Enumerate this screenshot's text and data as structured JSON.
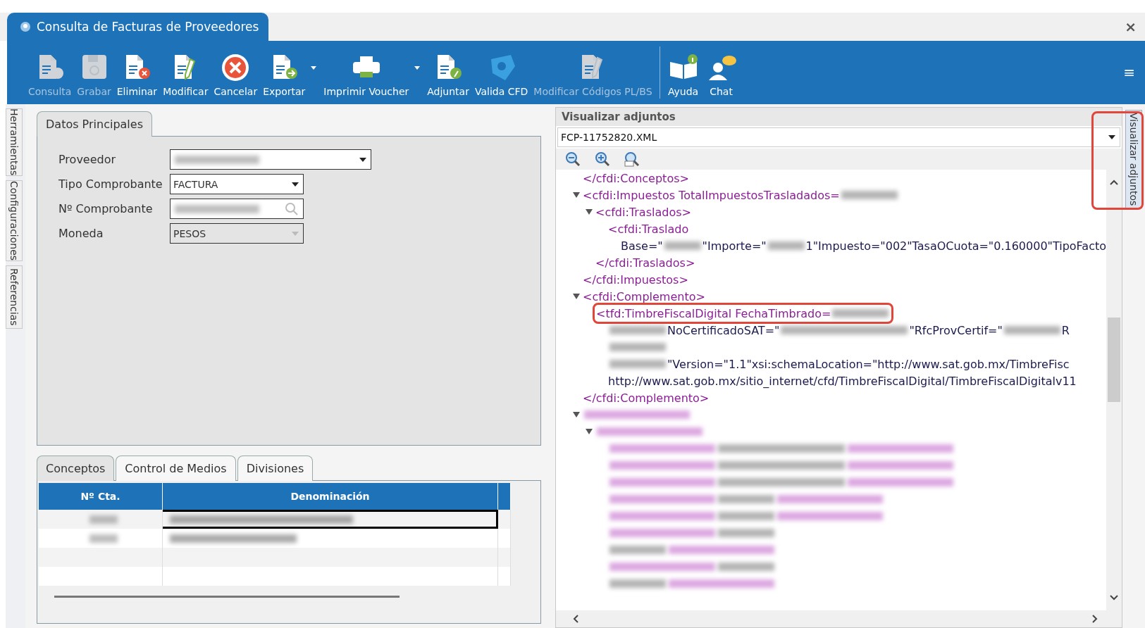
{
  "window": {
    "title": "Consulta de Facturas de Proveedores",
    "close": "×"
  },
  "toolbar": {
    "buttons": [
      {
        "label": "Consulta",
        "disabled": true
      },
      {
        "label": "Grabar",
        "disabled": true
      },
      {
        "label": "Eliminar",
        "disabled": false
      },
      {
        "label": "Modificar",
        "disabled": false
      },
      {
        "label": "Cancelar",
        "disabled": false
      },
      {
        "label": "Exportar",
        "disabled": false,
        "dropdown": true
      },
      {
        "label": "Imprimir Voucher",
        "disabled": false,
        "dropdown": true
      },
      {
        "label": "Adjuntar",
        "disabled": false
      },
      {
        "label": "Valida CFD",
        "disabled": false
      },
      {
        "label": "Modificar Códigos PL/BS",
        "disabled": true
      },
      {
        "label": "Ayuda",
        "disabled": false,
        "separated": true
      },
      {
        "label": "Chat",
        "disabled": false
      }
    ],
    "menu": "≡"
  },
  "side_tabs": [
    {
      "label": "Herramientas"
    },
    {
      "label": "Configuraciones"
    },
    {
      "label": "Referencias"
    }
  ],
  "main_tab": {
    "label": "Datos Principales",
    "selected": true
  },
  "form": {
    "fields": [
      {
        "label": "Proveedor",
        "kind": "dropdown",
        "redacted": true,
        "disabled": false
      },
      {
        "label": "Tipo Comprobante",
        "kind": "dropdown",
        "value": "FACTURA",
        "disabled": false
      },
      {
        "label": "Nº Comprobante",
        "kind": "search",
        "redacted": true,
        "disabled": false
      },
      {
        "label": "Moneda",
        "kind": "dropdown",
        "value": "PESOS",
        "disabled": true
      }
    ]
  },
  "detail_tabs": [
    {
      "label": "Conceptos",
      "selected": true
    },
    {
      "label": "Control de Medios",
      "selected": false
    },
    {
      "label": "Divisiones",
      "selected": false
    }
  ],
  "table": {
    "columns": [
      "Nº Cta.",
      "Denominación"
    ],
    "rows": [
      {
        "redacted": true,
        "selected": true
      },
      {
        "redacted": true,
        "selected": false
      }
    ]
  },
  "viewer": {
    "title": "Visualizar adjuntos",
    "file": "FCP-11752820.XML",
    "tree": [
      {
        "segments": [
          {
            "kind": "tag",
            "text": "</cfdi:Conceptos>"
          }
        ]
      },
      {
        "expanded": true,
        "segments": [
          {
            "kind": "tag",
            "text": "<cfdi:Impuestos "
          },
          {
            "kind": "tag",
            "text": "TotalImpuestosTrasladados="
          },
          {
            "kind": "blur-short"
          }
        ],
        "children": [
          {
            "expanded": true,
            "segments": [
              {
                "kind": "tag",
                "text": "<cfdi:Traslados>"
              }
            ],
            "children": [
              {
                "segments": [
                  {
                    "kind": "tag",
                    "text": "<cfdi:Traslado"
                  }
                ],
                "children": [
                  {
                    "segments": [
                      {
                        "kind": "text",
                        "text": "Base=\""
                      },
                      {
                        "kind": "blur-short"
                      },
                      {
                        "kind": "text",
                        "text": "\"Importe=\""
                      },
                      {
                        "kind": "blur-short"
                      },
                      {
                        "kind": "text",
                        "text": "1\"Impuesto=\"002\"TasaOCuota=\"0.160000\"TipoFacto"
                      }
                    ]
                  }
                ]
              }
            ],
            "closing": [
              {
                "kind": "tag",
                "text": "</cfdi:Traslados>"
              }
            ]
          }
        ],
        "closing": [
          {
            "kind": "tag",
            "text": "</cfdi:Impuestos>"
          }
        ]
      },
      {
        "expanded": true,
        "segments": [
          {
            "kind": "tag",
            "text": "<cfdi:Complemento>"
          }
        ],
        "children": [
          {
            "highlighted": true,
            "segments": [
              {
                "kind": "tag",
                "text": "<tfd:TimbreFiscalDigital FechaTimbrado="
              },
              {
                "kind": "blur-short"
              }
            ],
            "children": [
              {
                "segments": [
                  {
                    "kind": "blur-short"
                  },
                  {
                    "kind": "text",
                    "text": "NoCertificadoSAT=\""
                  },
                  {
                    "kind": "blur-long"
                  },
                  {
                    "kind": "text",
                    "text": "\"RfcProvCertif=\""
                  },
                  {
                    "kind": "blur-short"
                  },
                  {
                    "kind": "text",
                    "text": "R"
                  }
                ]
              },
              {
                "segments": [
                  {
                    "kind": "blur-short"
                  }
                ]
              },
              {
                "segments": [
                  {
                    "kind": "blur-short"
                  },
                  {
                    "kind": "text",
                    "text": "\"Version=\"1.1\"xsi:schemaLocation=\"http://www.sat.gob.mx/TimbreFisc"
                  }
                ]
              },
              {
                "segments": [
                  {
                    "kind": "text",
                    "text": "http://www.sat.gob.mx/sitio_internet/cfd/TimbreFiscalDigital/TimbreFiscalDigitalv11"
                  }
                ]
              }
            ]
          }
        ],
        "closing": [
          {
            "kind": "tag",
            "text": "</cfdi:Complemento>"
          }
        ]
      },
      {
        "expanded": true,
        "segments": [
          {
            "kind": "blur-tag"
          }
        ],
        "children": [
          {
            "expanded": true,
            "segments": [
              {
                "kind": "blur-tag"
              }
            ],
            "children": [
              {
                "segments": [
                  {
                    "kind": "blur-tag"
                  },
                  {
                    "kind": "blur-long"
                  },
                  {
                    "kind": "blur-tag"
                  }
                ]
              },
              {
                "segments": [
                  {
                    "kind": "blur-tag"
                  },
                  {
                    "kind": "blur-long"
                  },
                  {
                    "kind": "blur-tag"
                  }
                ]
              },
              {
                "segments": [
                  {
                    "kind": "blur-tag"
                  },
                  {
                    "kind": "blur-long"
                  },
                  {
                    "kind": "blur-tag"
                  }
                ]
              },
              {
                "segments": [
                  {
                    "kind": "blur-tag"
                  },
                  {
                    "kind": "blur-short"
                  },
                  {
                    "kind": "blur-tag"
                  }
                ]
              },
              {
                "segments": [
                  {
                    "kind": "blur-tag"
                  },
                  {
                    "kind": "blur-short"
                  },
                  {
                    "kind": "blur-tag"
                  }
                ]
              },
              {
                "segments": [
                  {
                    "kind": "blur-tag"
                  },
                  {
                    "kind": "blur-short"
                  }
                ]
              },
              {
                "segments": [
                  {
                    "kind": "blur-short"
                  },
                  {
                    "kind": "blur-tag"
                  }
                ]
              },
              {
                "segments": [
                  {
                    "kind": "blur-tag"
                  },
                  {
                    "kind": "blur-short"
                  }
                ]
              },
              {
                "segments": [
                  {
                    "kind": "blur-short"
                  },
                  {
                    "kind": "blur-tag"
                  }
                ]
              }
            ]
          }
        ]
      }
    ]
  },
  "right_tab": {
    "label": "Visualizar adjuntos",
    "highlighted": true
  }
}
